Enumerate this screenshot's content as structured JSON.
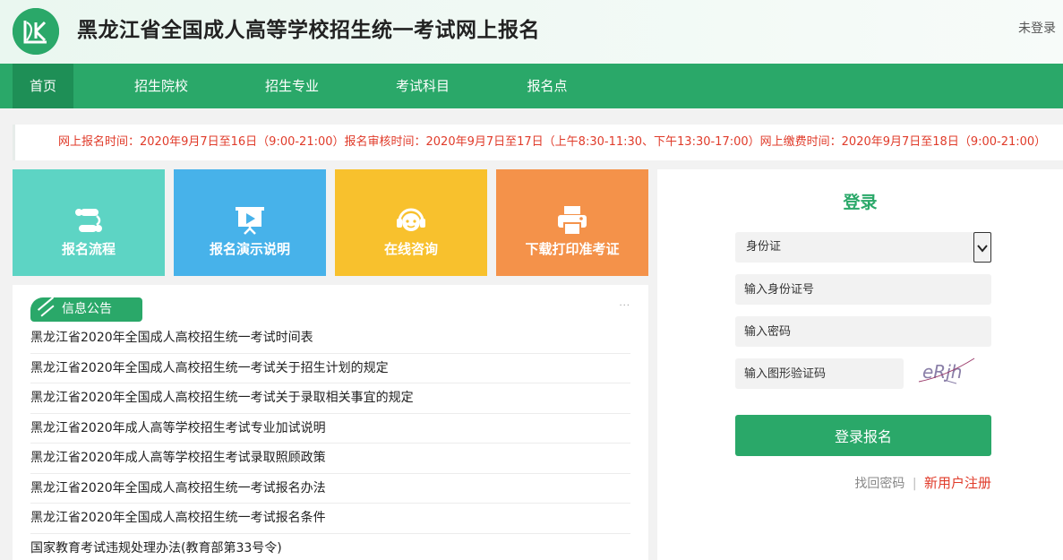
{
  "header": {
    "logo_text": "LK",
    "title": "黑龙江省全国成人高等学校招生统一考试网上报名",
    "login_status": "未登录"
  },
  "nav": {
    "items": [
      {
        "label": "首页",
        "active": true
      },
      {
        "label": "招生院校",
        "active": false
      },
      {
        "label": "招生专业",
        "active": false
      },
      {
        "label": "考试科目",
        "active": false
      },
      {
        "label": "报名点",
        "active": false
      }
    ]
  },
  "notice": {
    "text": "网上报名时间：2020年9月7日至16日（9:00-21:00）报名审核时间：2020年9月7日至17日（上午8:30-11:30、下午13:30-17:00）网上缴费时间：2020年9月7日至18日（9:00-21:00）"
  },
  "tiles": [
    {
      "label": "报名流程",
      "icon": "flow-icon",
      "color": "#5dd4c4"
    },
    {
      "label": "报名演示说明",
      "icon": "presentation-icon",
      "color": "#47b2ea"
    },
    {
      "label": "在线咨询",
      "icon": "headset-icon",
      "color": "#f8c12d"
    },
    {
      "label": "下载打印准考证",
      "icon": "printer-icon",
      "color": "#f4924a"
    }
  ],
  "news": {
    "tab_label": "信息公告",
    "more": "···",
    "items": [
      "黑龙江省2020年全国成人高校招生统一考试时间表",
      "黑龙江省2020年全国成人高校招生统一考试关于招生计划的规定",
      "黑龙江省2020年全国成人高校招生统一考试关于录取相关事宜的规定",
      "黑龙江省2020年成人高等学校招生考试专业加试说明",
      "黑龙江省2020年成人高等学校招生考试录取照顾政策",
      "黑龙江省2020年全国成人高校招生统一考试报名办法",
      "黑龙江省2020年全国成人高校招生统一考试报名条件",
      "国家教育考试违规处理办法(教育部第33号令)"
    ]
  },
  "login": {
    "title": "登录",
    "id_type_selected": "身份证",
    "id_placeholder": "输入身份证号",
    "password_placeholder": "输入密码",
    "captcha_placeholder": "输入图形验证码",
    "captcha_text": "eRjh",
    "submit_label": "登录报名",
    "forgot_label": "找回密码",
    "separator": "|",
    "register_label": "新用户注册"
  },
  "colors": {
    "brand_green": "#2aa869",
    "nav_active": "#1e8f56",
    "notice_red": "#e03b2a"
  }
}
